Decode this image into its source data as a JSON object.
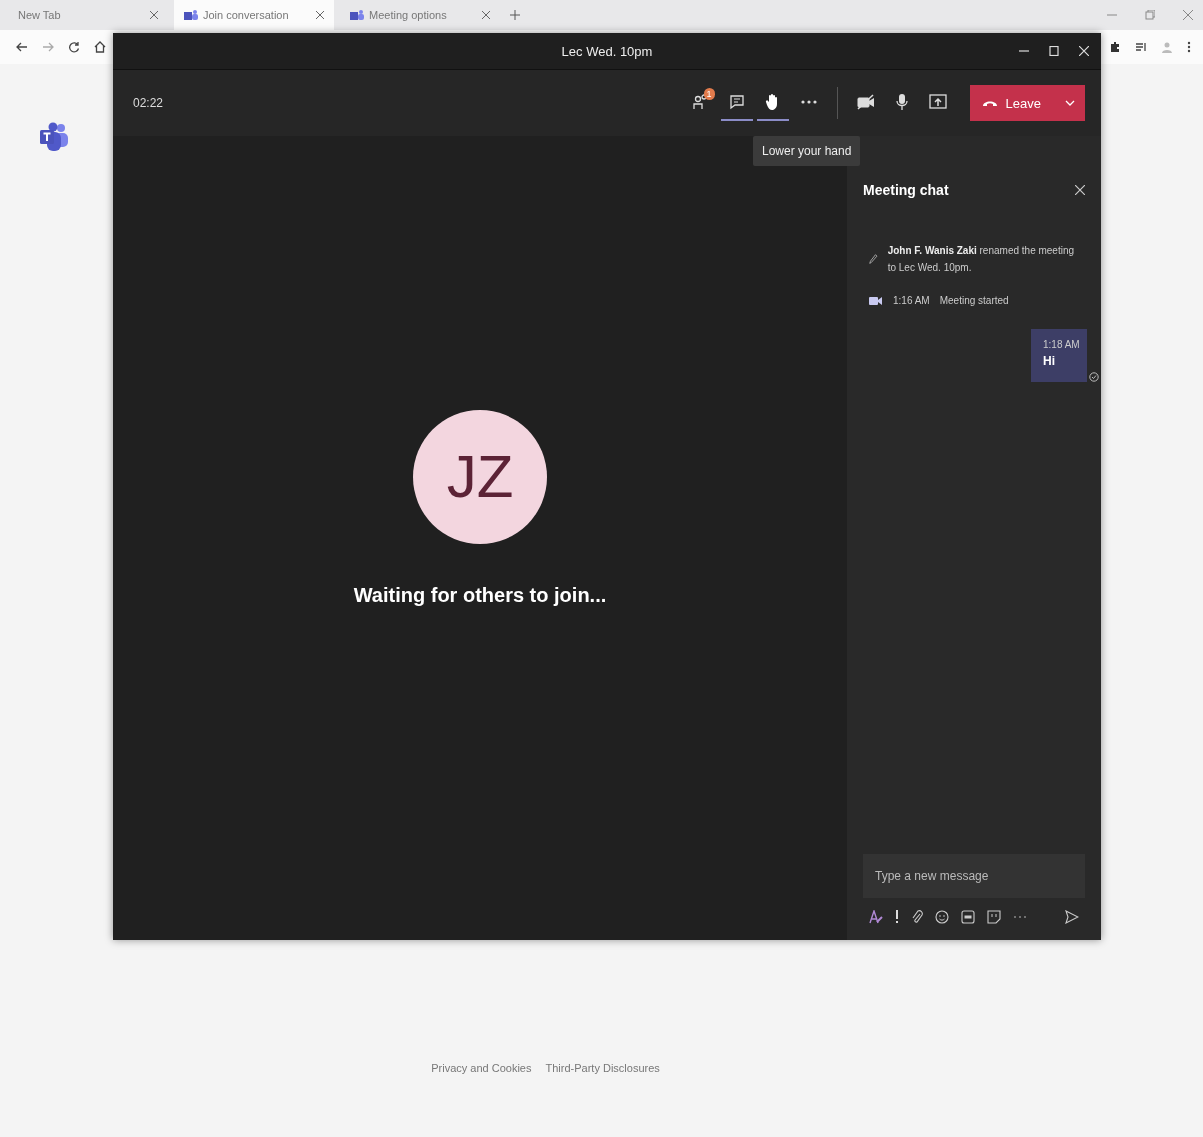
{
  "browser": {
    "tabs": [
      {
        "label": "New Tab",
        "selected": false,
        "icon": false
      },
      {
        "label": "Join conversation",
        "selected": true,
        "icon": true
      },
      {
        "label": "Meeting options",
        "selected": false,
        "icon": true
      }
    ]
  },
  "window": {
    "title": "Lec Wed. 10pm"
  },
  "call": {
    "timer": "02:22",
    "participants_badge": "1",
    "toolbar": [
      {
        "kind": "chat",
        "selected": true
      },
      {
        "kind": "hand",
        "selected": true
      },
      {
        "kind": "more",
        "selected": false
      }
    ],
    "devices": [
      {
        "kind": "camera",
        "on": false
      },
      {
        "kind": "mic",
        "on": true
      },
      {
        "kind": "share",
        "on": false
      }
    ],
    "leave_button": "Leave",
    "tooltip": "Lower your hand",
    "avatar_initials": "JZ",
    "status": "Waiting for others to join..."
  },
  "chat": {
    "title": "Meeting chat",
    "events": [
      {
        "kind": "rename",
        "text": "**John F. Wanis Zaki** renamed the meeting to Lec Wed. 10pm."
      },
      {
        "kind": "started",
        "time": "1:16 AM",
        "text": "Meeting started"
      }
    ],
    "messages": [
      {
        "time": "1:18 AM",
        "text": "Hi"
      }
    ],
    "placeholder": "Type a new message"
  },
  "footer": {
    "links": [
      "Privacy and Cookies",
      "Third-Party Disclosures"
    ]
  }
}
